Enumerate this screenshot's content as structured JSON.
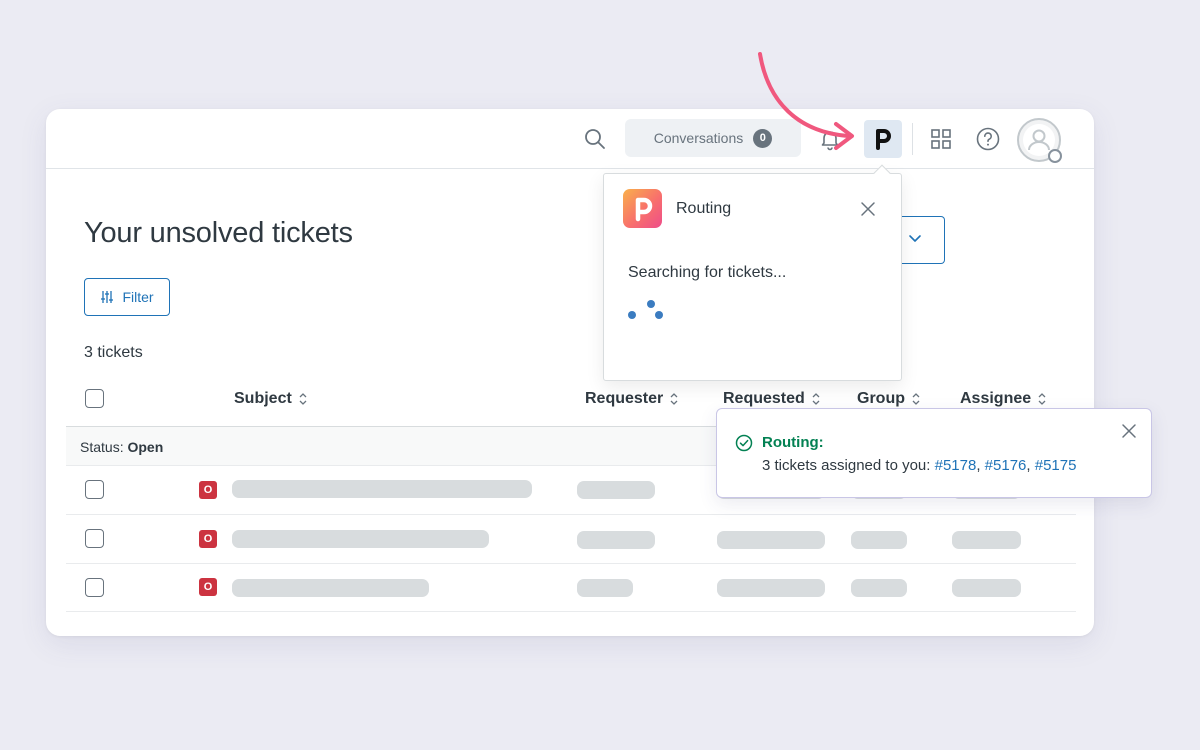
{
  "topbar": {
    "conversations_label": "Conversations",
    "conversations_count": "0",
    "app_button_letter": "P"
  },
  "main": {
    "title": "Your unsolved tickets",
    "filter_label": "Filter",
    "tickets_count": "3 tickets",
    "columns": [
      "Subject",
      "Requester",
      "Requested",
      "Group",
      "Assignee"
    ],
    "group_status_label": "Status:",
    "group_status_value": "Open",
    "ticket_status_badge": "O"
  },
  "routing_popover": {
    "title": "Routing",
    "logo_letter": "P",
    "message": "Searching for tickets..."
  },
  "toast": {
    "title": "Routing:",
    "message": "3 tickets assigned to you:",
    "ticket_links": [
      "#5178",
      "#5176",
      "#5175"
    ],
    "separator": ","
  },
  "colors": {
    "accent": "#1f73b7",
    "success": "#038153",
    "badge_open": "#cc3340",
    "arrow": "#f0587e",
    "background": "#ebebf3"
  }
}
